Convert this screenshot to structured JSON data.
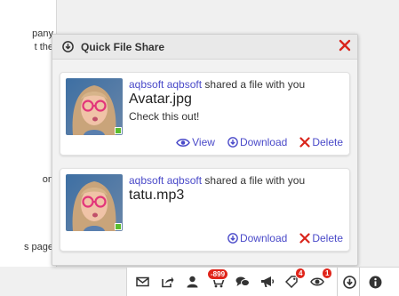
{
  "background": {
    "left_fragments": [
      "pany",
      "t the",
      "on",
      "s page"
    ]
  },
  "panel": {
    "title": "Quick File Share",
    "icon": "download-circle-icon",
    "close_icon": "close-x-icon"
  },
  "shares": [
    {
      "user": "aqbsoft aqbsoft",
      "action_text": " shared a file with you",
      "filename": "Avatar.jpg",
      "message": "Check this out!",
      "online": true,
      "actions": {
        "view": "View",
        "download": "Download",
        "delete": "Delete"
      }
    },
    {
      "user": "aqbsoft aqbsoft",
      "action_text": " shared a file with you",
      "filename": "tatu.mp3",
      "message": "",
      "online": true,
      "actions": {
        "download": "Download",
        "delete": "Delete"
      }
    }
  ],
  "toolbar": {
    "items": [
      {
        "name": "mail-icon"
      },
      {
        "name": "share-icon"
      },
      {
        "name": "user-icon"
      },
      {
        "name": "cart-icon",
        "badge": "-899"
      },
      {
        "name": "chat-icon"
      },
      {
        "name": "megaphone-icon"
      },
      {
        "name": "tag-icon",
        "badge": "4"
      },
      {
        "name": "eye-icon",
        "badge": "1"
      },
      {
        "name": "download-circle-icon",
        "active": true
      },
      {
        "name": "info-icon"
      }
    ]
  },
  "colors": {
    "link": "#4a4ac9",
    "delete": "#d9251c",
    "badge": "#e0251b",
    "online": "#5bbd2d"
  }
}
